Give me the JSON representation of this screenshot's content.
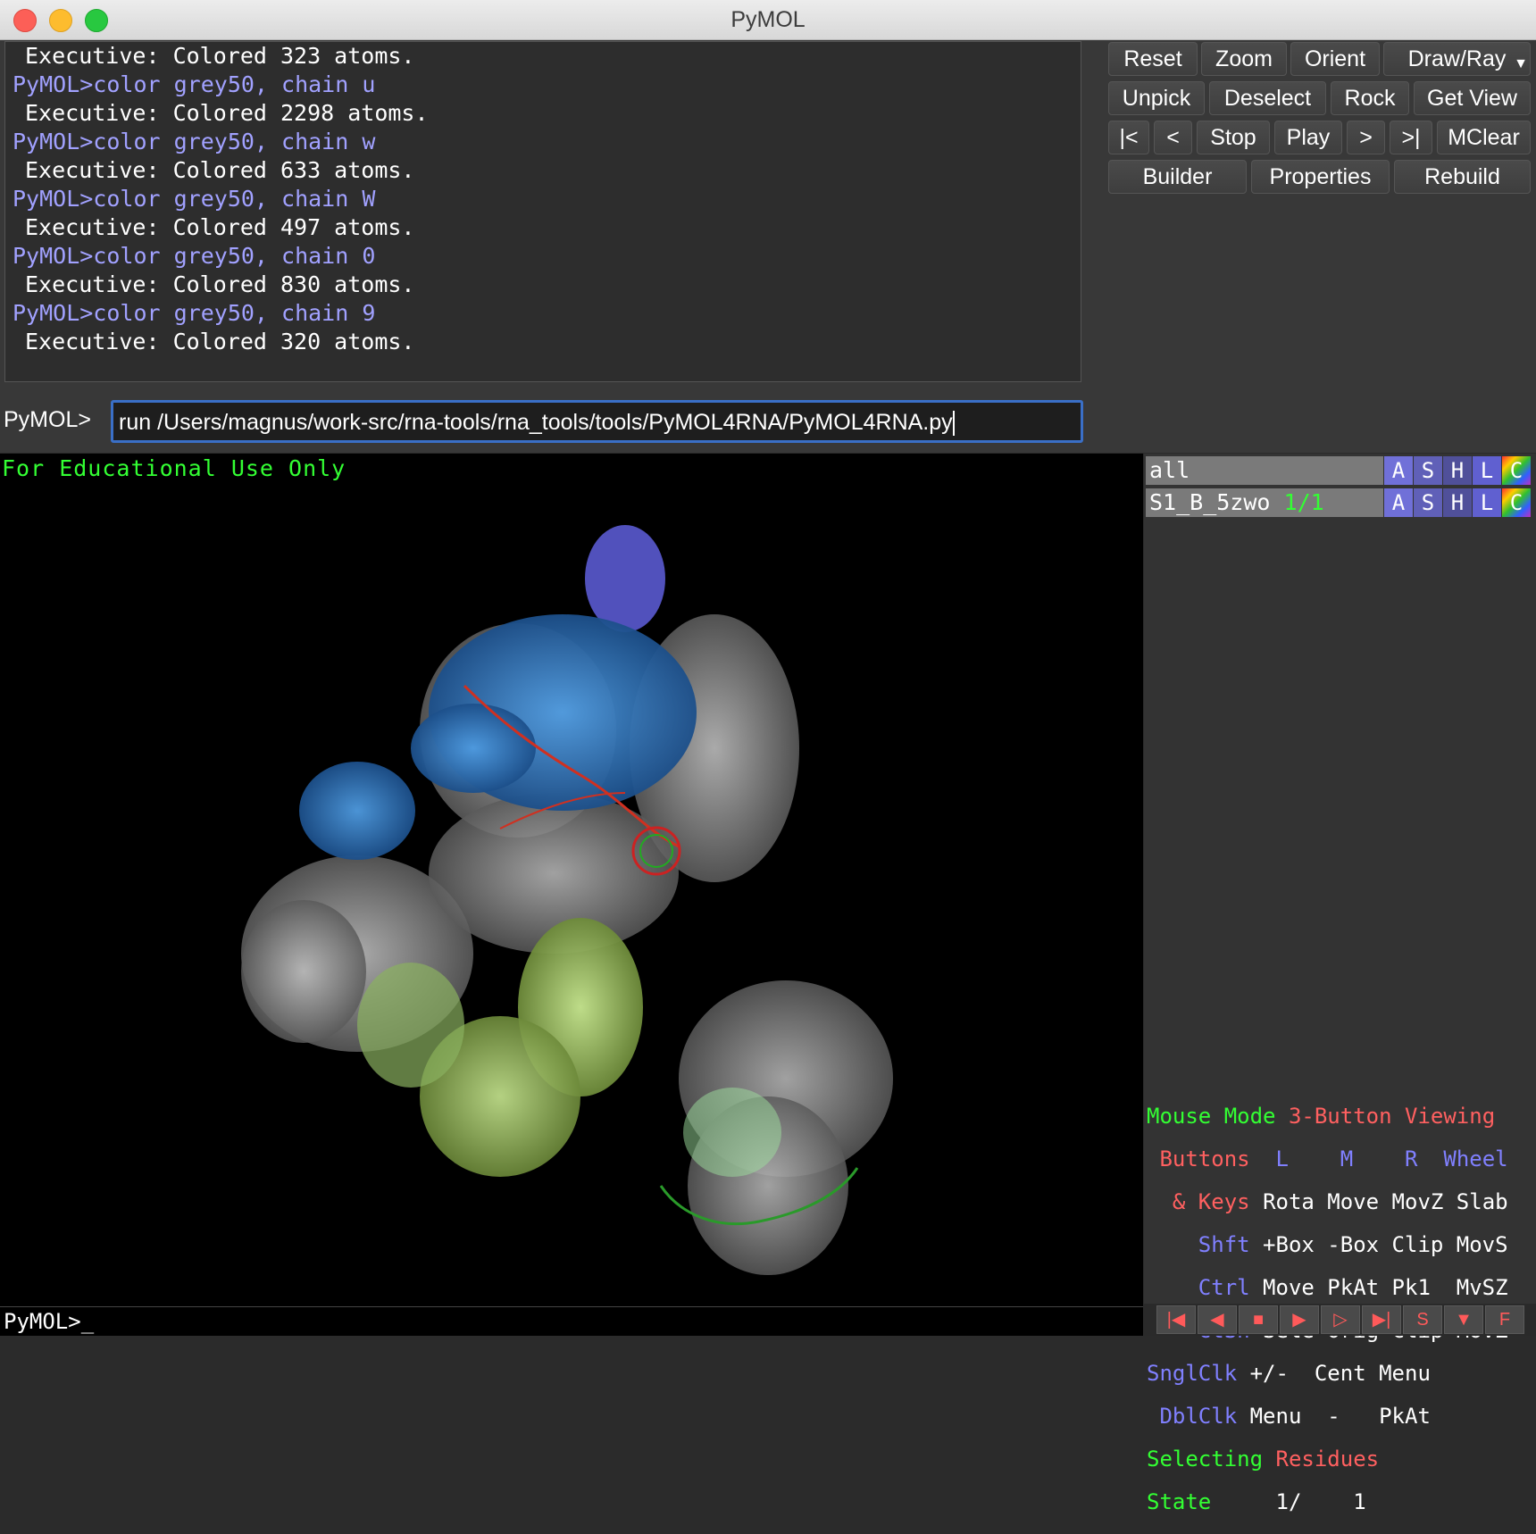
{
  "window": {
    "title": "PyMOL"
  },
  "log": [
    {
      "type": "out",
      "text": "Executive: Colored 323 atoms."
    },
    {
      "type": "cmd",
      "text": "PyMOL>color grey50, chain u"
    },
    {
      "type": "out",
      "text": "Executive: Colored 2298 atoms."
    },
    {
      "type": "cmd",
      "text": "PyMOL>color grey50, chain w"
    },
    {
      "type": "out",
      "text": "Executive: Colored 633 atoms."
    },
    {
      "type": "cmd",
      "text": "PyMOL>color grey50, chain W"
    },
    {
      "type": "out",
      "text": "Executive: Colored 497 atoms."
    },
    {
      "type": "cmd",
      "text": "PyMOL>color grey50, chain 0"
    },
    {
      "type": "out",
      "text": "Executive: Colored 830 atoms."
    },
    {
      "type": "cmd",
      "text": "PyMOL>color grey50, chain 9"
    },
    {
      "type": "out",
      "text": "Executive: Colored 320 atoms."
    }
  ],
  "command": {
    "label": "PyMOL>",
    "value": "run /Users/magnus/work-src/rna-tools/rna_tools/tools/PyMOL4RNA/PyMOL4RNA.py"
  },
  "buttons": {
    "reset": "Reset",
    "zoom": "Zoom",
    "orient": "Orient",
    "draw_ray": "Draw/Ray",
    "unpick": "Unpick",
    "deselect": "Deselect",
    "rock": "Rock",
    "get_view": "Get View",
    "first": "|<",
    "prev": "<",
    "stop": "Stop",
    "play": "Play",
    "next": ">",
    "last": ">|",
    "mclear": "MClear",
    "builder": "Builder",
    "properties": "Properties",
    "rebuild": "Rebuild"
  },
  "viewer": {
    "watermark": "For Educational Use Only"
  },
  "objects": [
    {
      "name": "all",
      "state": ""
    },
    {
      "name": "S1_B_5zwo",
      "state": "1/1"
    }
  ],
  "object_buttons": [
    "A",
    "S",
    "H",
    "L",
    "C"
  ],
  "mouse": {
    "title_a": "Mouse Mode",
    "title_b": "3-Button Viewing",
    "buttons_label": "Buttons",
    "col_L": "L",
    "col_M": "M",
    "col_R": "R",
    "col_wheel": "Wheel",
    "rows": [
      {
        "key": "& Keys",
        "v": "Rota Move MovZ Slab"
      },
      {
        "key": "Shft",
        "v": "+Box -Box Clip MovS"
      },
      {
        "key": "Ctrl",
        "v": "Move PkAt Pk1  MvSZ"
      },
      {
        "key": "CtSh",
        "v": "Sele Orig Clip MovZ"
      },
      {
        "key": "SnglClk",
        "v": "+/-  Cent Menu"
      },
      {
        "key": "DblClk",
        "v": "Menu  -   PkAt"
      }
    ],
    "selecting_a": "Selecting",
    "selecting_b": "Residues",
    "state_label": "State",
    "state_value": "1/    1"
  },
  "bottom_prompt": "PyMOL>_",
  "controls": [
    "|◀",
    "◀",
    "■",
    "▶",
    "▷",
    "▶|",
    "S",
    "▼",
    "F"
  ]
}
